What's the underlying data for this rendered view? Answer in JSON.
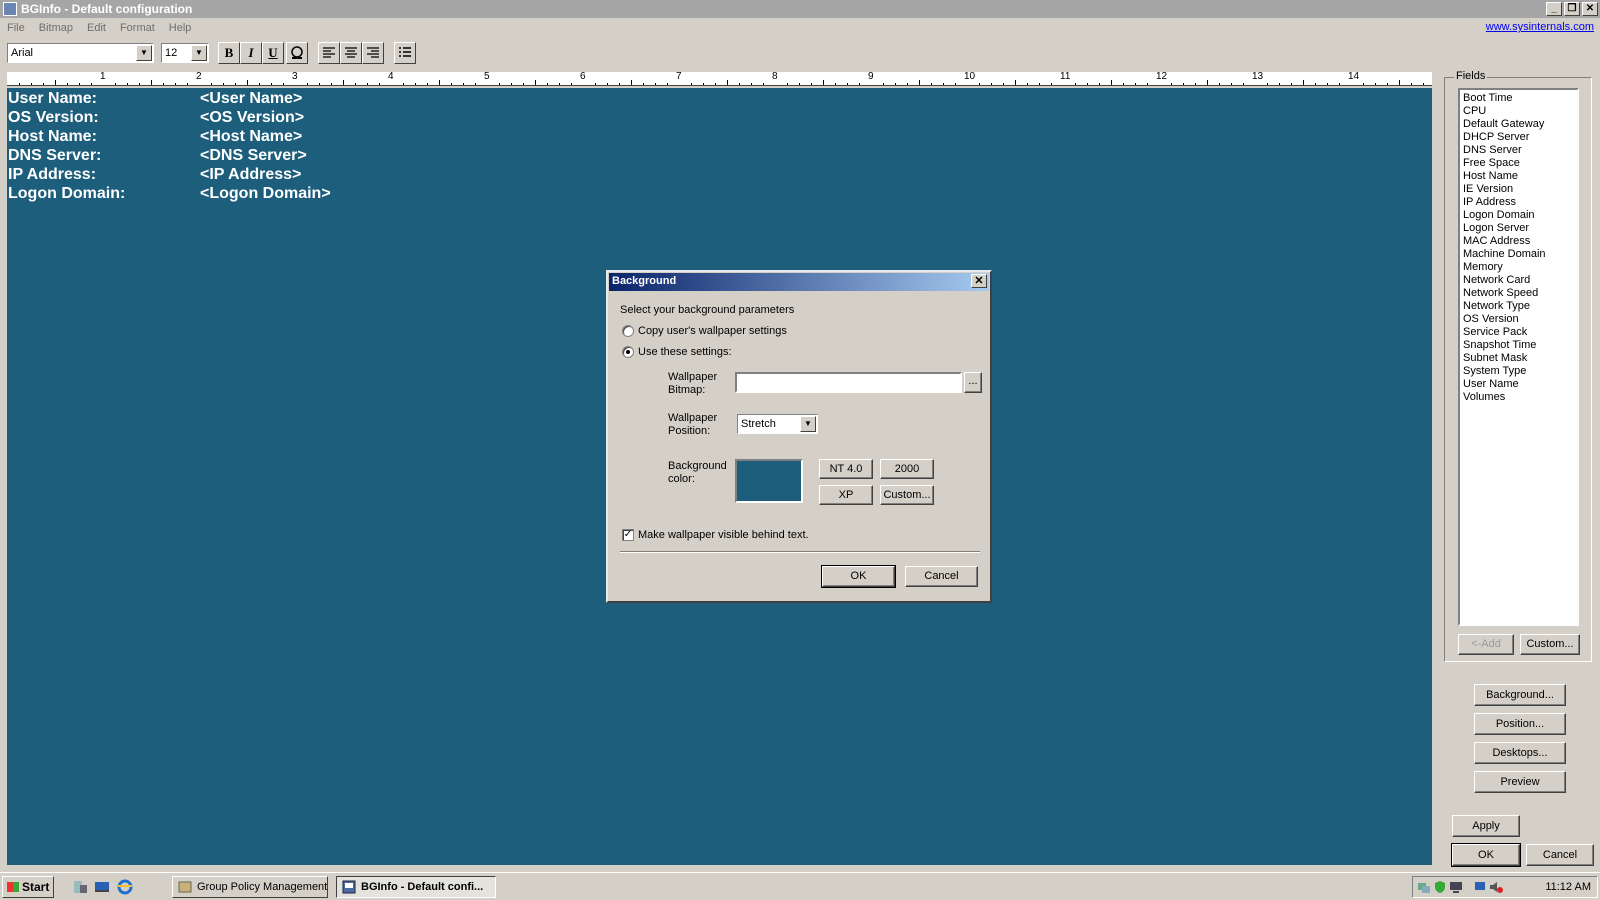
{
  "window": {
    "title": "BGInfo - Default configuration",
    "controls": [
      "minimize",
      "restore",
      "close"
    ]
  },
  "menu": {
    "items": [
      "File",
      "Bitmap",
      "Edit",
      "Format",
      "Help"
    ],
    "link": "www.sysinternals.com"
  },
  "toolbar": {
    "font": "Arial",
    "size": "12",
    "bold": "B",
    "italic": "I",
    "underline": "U"
  },
  "ruler": {
    "labels": [
      "1",
      "2",
      "3",
      "4",
      "5",
      "6",
      "7",
      "8",
      "9",
      "10",
      "11",
      "12",
      "13",
      "14"
    ]
  },
  "canvas": {
    "background": "#1d5e7c",
    "rows": [
      {
        "label": "User Name:",
        "value": "<User Name>"
      },
      {
        "label": "OS Version:",
        "value": "<OS Version>"
      },
      {
        "label": "Host Name:",
        "value": "<Host Name>"
      },
      {
        "label": "DNS Server:",
        "value": "<DNS Server>"
      },
      {
        "label": "IP Address:",
        "value": "<IP Address>"
      },
      {
        "label": "Logon Domain:",
        "value": "<Logon Domain>"
      }
    ]
  },
  "fields": {
    "caption": "Fields",
    "items": [
      "Boot Time",
      "CPU",
      "Default Gateway",
      "DHCP Server",
      "DNS Server",
      "Free Space",
      "Host Name",
      "IE Version",
      "IP Address",
      "Logon Domain",
      "Logon Server",
      "MAC Address",
      "Machine Domain",
      "Memory",
      "Network Card",
      "Network Speed",
      "Network Type",
      "OS Version",
      "Service Pack",
      "Snapshot Time",
      "Subnet Mask",
      "System Type",
      "User Name",
      "Volumes"
    ],
    "add_label": "<-Add",
    "custom_label": "Custom..."
  },
  "side_buttons": {
    "background": "Background...",
    "position": "Position...",
    "desktops": "Desktops...",
    "preview": "Preview",
    "apply": "Apply",
    "ok": "OK",
    "cancel": "Cancel"
  },
  "dialog": {
    "title": "Background",
    "intro": "Select your background parameters",
    "radio_copy": "Copy user's wallpaper settings",
    "radio_use": "Use these settings:",
    "selected_radio": "Use these settings:",
    "wallpaper_bitmap_label": "Wallpaper\nBitmap:",
    "wallpaper_bitmap_value": "",
    "browse_label": "...",
    "wallpaper_position_label": "Wallpaper\nPosition:",
    "wallpaper_position_value": "Stretch",
    "background_color_label": "Background\ncolor:",
    "background_color": "#1d5e7c",
    "btn_nt40": "NT 4.0",
    "btn_2000": "2000",
    "btn_xp": "XP",
    "btn_custom": "Custom...",
    "visible_behind_text": "Make wallpaper visible behind text.",
    "visible_behind_checked": true,
    "ok": "OK",
    "cancel": "Cancel"
  },
  "taskbar": {
    "start": "Start",
    "tasks": [
      "Group Policy Management",
      "BGInfo - Default confi..."
    ],
    "active_task": "BGInfo - Default confi...",
    "clock": "11:12 AM"
  }
}
